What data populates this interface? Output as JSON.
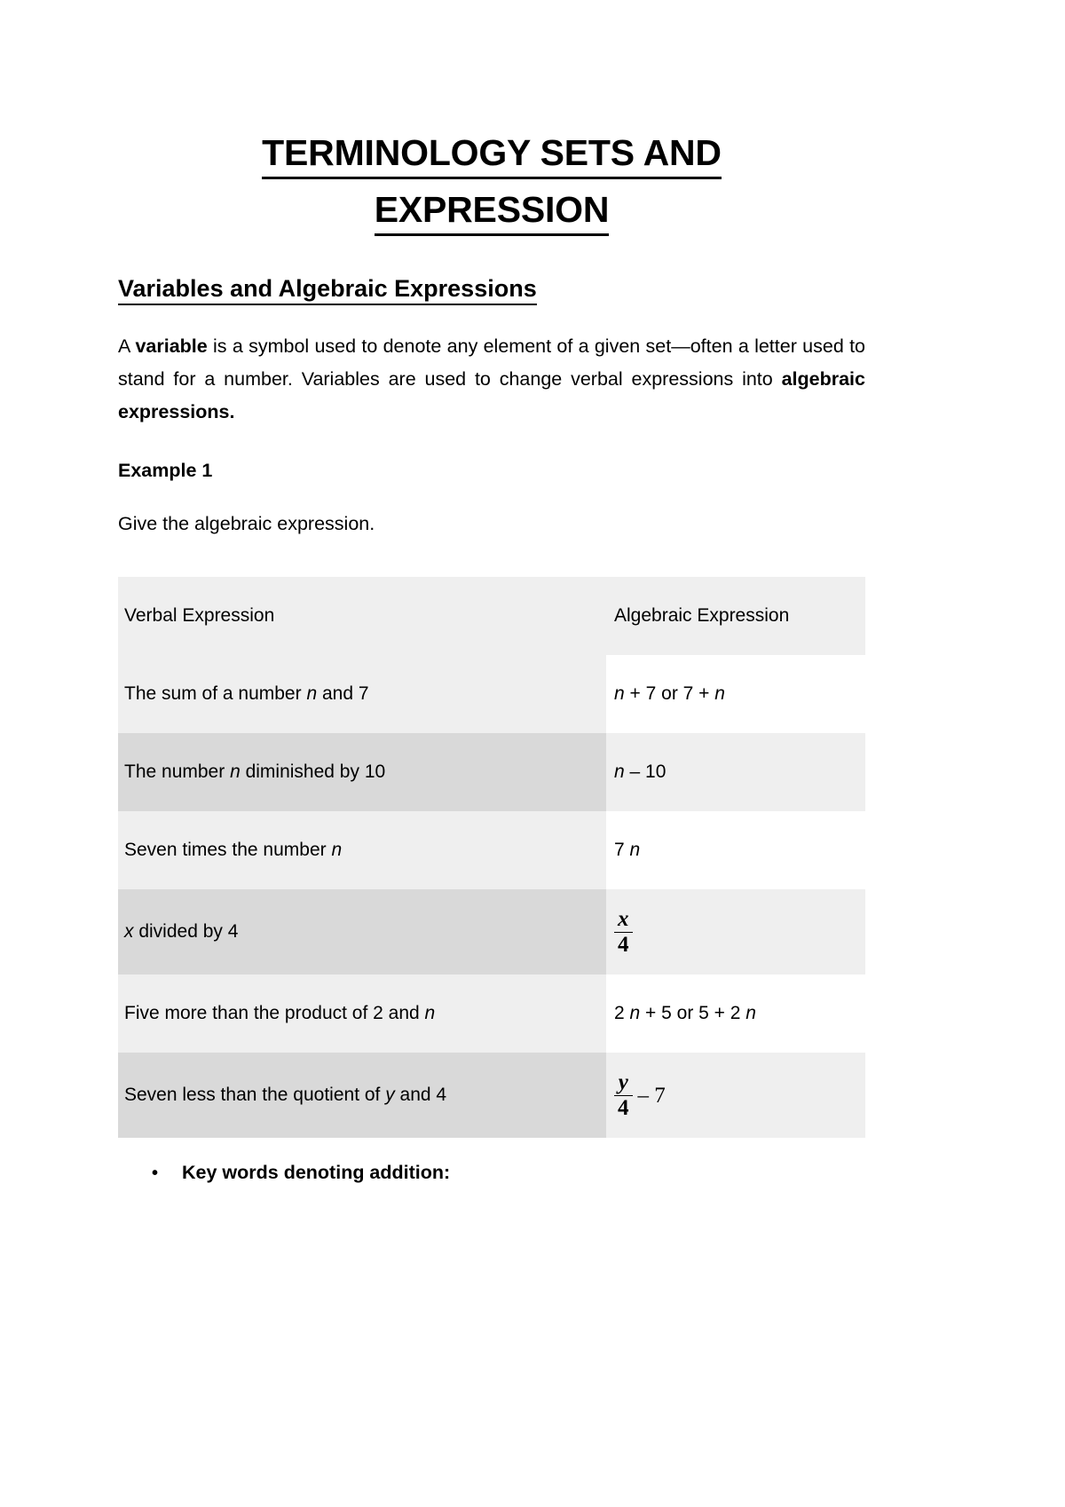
{
  "document": {
    "title_line1": "TERMINOLOGY SETS AND",
    "title_line2": "EXPRESSION",
    "section_heading": "Variables and Algebraic Expressions",
    "paragraph": {
      "part1": "A ",
      "bold1": "variable",
      "part2": " is a symbol used to denote any element of a given set—often a letter used to stand for a number. Variables are used to change verbal expressions into ",
      "bold2": "algebraic expressions."
    },
    "example_label": "Example 1",
    "instruction": "Give the algebraic expression.",
    "bullet": {
      "marker": "•",
      "text": "Key words denoting addition:"
    }
  },
  "table": {
    "headers": [
      "Verbal Expression",
      "Algebraic Expression"
    ],
    "rows": [
      {
        "verbal_pre": "The sum of a number ",
        "verbal_var": "n",
        "verbal_post": " and 7",
        "algebraic_type": "text",
        "algebraic_pre": "",
        "algebraic_var1": "n",
        "algebraic_mid": " + 7 or 7 + ",
        "algebraic_var2": "n",
        "algebraic_post": ""
      },
      {
        "verbal_pre": "The number ",
        "verbal_var": "n",
        "verbal_post": " diminished by 10",
        "algebraic_type": "text",
        "algebraic_pre": "",
        "algebraic_var1": "n",
        "algebraic_mid": " – 10",
        "algebraic_var2": "",
        "algebraic_post": ""
      },
      {
        "verbal_pre": "Seven times the number ",
        "verbal_var": "n",
        "verbal_post": "",
        "algebraic_type": "text",
        "algebraic_pre": "7 ",
        "algebraic_var1": "n",
        "algebraic_mid": "",
        "algebraic_var2": "",
        "algebraic_post": ""
      },
      {
        "verbal_pre": "",
        "verbal_var": "x",
        "verbal_post": " divided by 4",
        "algebraic_type": "fraction",
        "numerator": "x",
        "denominator": "4",
        "frac_tail": ""
      },
      {
        "verbal_pre": "Five more than the product of 2 and ",
        "verbal_var": "n",
        "verbal_post": "",
        "algebraic_type": "text",
        "algebraic_pre": "2 ",
        "algebraic_var1": "n",
        "algebraic_mid": " + 5 or 5 + 2 ",
        "algebraic_var2": "n",
        "algebraic_post": ""
      },
      {
        "verbal_pre": "Seven less than the quotient of ",
        "verbal_var": "y",
        "verbal_post": " and 4",
        "algebraic_type": "fraction",
        "numerator": "y",
        "denominator": "4",
        "frac_tail": "– 7"
      }
    ]
  },
  "colors": {
    "page_background": "#ffffff",
    "text": "#000000",
    "row_light": "#efefef",
    "row_dark": "#d9d9d9",
    "row_white": "#ffffff"
  }
}
